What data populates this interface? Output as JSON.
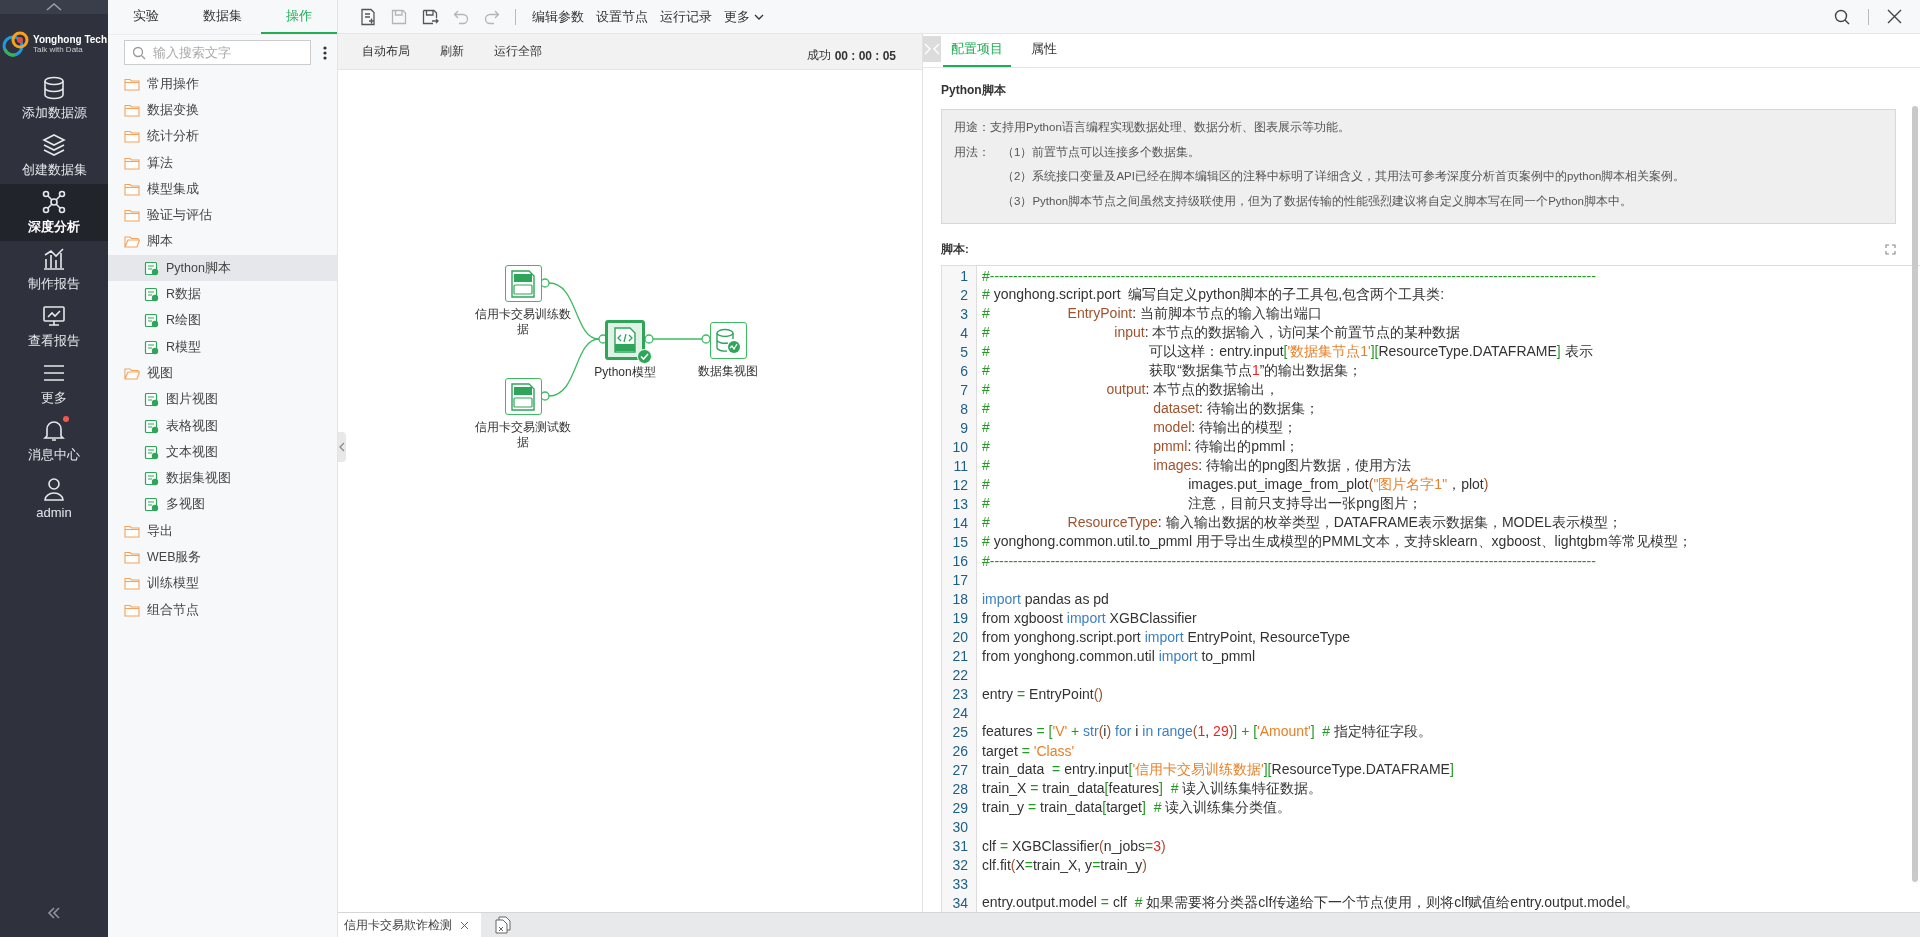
{
  "nav": {
    "logo": {
      "name": "Yonghong Tech",
      "slogan": "Talk with Data"
    },
    "items": [
      {
        "label": "添加数据源",
        "selected": false,
        "unread": false
      },
      {
        "label": "创建数据集",
        "selected": false,
        "unread": false
      },
      {
        "label": "深度分析",
        "selected": true,
        "unread": false
      },
      {
        "label": "制作报告",
        "selected": false,
        "unread": false
      },
      {
        "label": "查看报告",
        "selected": false,
        "unread": false
      },
      {
        "label": "更多",
        "selected": false,
        "unread": false
      },
      {
        "label": "消息中心",
        "selected": false,
        "unread": true
      },
      {
        "label": "admin",
        "selected": false,
        "unread": false
      }
    ]
  },
  "tree_panel": {
    "tabs": [
      {
        "label": "实验",
        "selected": false
      },
      {
        "label": "数据集",
        "selected": false
      },
      {
        "label": "操作",
        "selected": true
      }
    ],
    "search": {
      "placeholder": "输入搜索文字"
    },
    "items": [
      {
        "label": "常用操作",
        "expanded": false,
        "selected": false
      },
      {
        "label": "数据变换",
        "expanded": false,
        "selected": false
      },
      {
        "label": "统计分析",
        "expanded": false,
        "selected": false
      },
      {
        "label": "算法",
        "expanded": false,
        "selected": false
      },
      {
        "label": "模型集成",
        "expanded": false,
        "selected": false
      },
      {
        "label": "验证与评估",
        "expanded": false,
        "selected": false
      },
      {
        "label": "脚本",
        "expanded": true,
        "selected": false,
        "children": [
          {
            "label": "Python脚本",
            "selected": true
          },
          {
            "label": "R数据",
            "selected": false
          },
          {
            "label": "R绘图",
            "selected": false
          },
          {
            "label": "R模型",
            "selected": false
          }
        ]
      },
      {
        "label": "视图",
        "expanded": true,
        "selected": false,
        "children": [
          {
            "label": "图片视图",
            "selected": false
          },
          {
            "label": "表格视图",
            "selected": false
          },
          {
            "label": "文本视图",
            "selected": false
          },
          {
            "label": "数据集视图",
            "selected": false
          },
          {
            "label": "多视图",
            "selected": false
          }
        ]
      },
      {
        "label": "导出",
        "expanded": false,
        "selected": false
      },
      {
        "label": "WEB服务",
        "expanded": false,
        "selected": false
      },
      {
        "label": "训练模型",
        "expanded": false,
        "selected": false
      },
      {
        "label": "组合节点",
        "expanded": false,
        "selected": false
      }
    ]
  },
  "toolbar": {
    "icon_buttons": [
      {
        "disabled": false
      },
      {
        "disabled": true
      },
      {
        "disabled": false
      },
      {
        "disabled": true
      },
      {
        "disabled": true
      }
    ],
    "buttons": [
      "编辑参数",
      "设置节点",
      "运行记录"
    ],
    "more": "更多"
  },
  "canvas_bar": {
    "buttons": [
      "自动布局",
      "刷新",
      "运行全部"
    ],
    "status": "成功",
    "elapsed": "00 : 00 : 05"
  },
  "flow": {
    "nodes": [
      {
        "label": "信用卡交易训练数据",
        "kind": "sql",
        "done": false
      },
      {
        "label": "信用卡交易测试数据",
        "kind": "sql",
        "done": false
      },
      {
        "label": "Python模型",
        "kind": "python",
        "done": true
      },
      {
        "label": "数据集视图",
        "kind": "dataset",
        "done": false
      }
    ]
  },
  "config_panel": {
    "tabs": [
      {
        "label": "配置项目",
        "selected": true
      },
      {
        "label": "属性",
        "selected": false
      }
    ],
    "title": "Python脚本",
    "description": {
      "usage": "用途：支持用Python语言编程实现数据处理、数据分析、图表展示等功能。",
      "method_label": "用法：",
      "method_items": [
        "（1）前置节点可以连接多个数据集。",
        "（2）系统接口变量及API已经在脚本编辑区的注释中标明了详细含义，其用法可参考深度分析首页案例中的python脚本相关案例。",
        "（3）Python脚本节点之间虽然支持级联使用，但为了数据传输的性能强烈建议将自定义脚本写在同一个Python脚本中。"
      ]
    },
    "script_label": "脚本:",
    "code_lines": [
      {
        "no": "1",
        "segs": [
          {
            "text": "#----------------------------------------------------------------------------------------------------------------------------------",
            "kind": "comment"
          }
        ]
      },
      {
        "no": "2",
        "segs": [
          {
            "text": "#",
            "kind": "comment"
          },
          {
            "text": " yonghong.script.port  编写自定义python脚本的子工具包,包含两个工具类:",
            "kind": "plain"
          }
        ]
      },
      {
        "no": "3",
        "segs": [
          {
            "text": "#",
            "kind": "comment"
          },
          {
            "text": "                    EntryPoint",
            "kind": "name"
          },
          {
            "text": ": 当前脚本节点的输入输出端口",
            "kind": "plain"
          }
        ]
      },
      {
        "no": "4",
        "segs": [
          {
            "text": "#",
            "kind": "comment"
          },
          {
            "text": "                                input",
            "kind": "name"
          },
          {
            "text": ": 本节点的数据输入，访问某个前置节点的某种数据",
            "kind": "plain"
          }
        ]
      },
      {
        "no": "5",
        "segs": [
          {
            "text": "#",
            "kind": "comment"
          },
          {
            "text": "                                         可以这样：entry.input",
            "kind": "plain"
          },
          {
            "text": "[",
            "kind": "punct"
          },
          {
            "text": "'数据集节点1'",
            "kind": "string"
          },
          {
            "text": "][",
            "kind": "punct"
          },
          {
            "text": "ResourceType.DATAFRAME",
            "kind": "plain"
          },
          {
            "text": "]",
            "kind": "punct"
          },
          {
            "text": " 表示",
            "kind": "plain"
          }
        ]
      },
      {
        "no": "6",
        "segs": [
          {
            "text": "#",
            "kind": "comment"
          },
          {
            "text": "                                         获取“数据集节点",
            "kind": "plain"
          },
          {
            "text": "1",
            "kind": "number"
          },
          {
            "text": "”的输出数据集；",
            "kind": "plain"
          }
        ]
      },
      {
        "no": "7",
        "segs": [
          {
            "text": "#",
            "kind": "comment"
          },
          {
            "text": "                              output",
            "kind": "name"
          },
          {
            "text": ": 本节点的数据输出，",
            "kind": "plain"
          }
        ]
      },
      {
        "no": "8",
        "segs": [
          {
            "text": "#",
            "kind": "comment"
          },
          {
            "text": "                                          dataset",
            "kind": "name"
          },
          {
            "text": ": 待输出的数据集；",
            "kind": "plain"
          }
        ]
      },
      {
        "no": "9",
        "segs": [
          {
            "text": "#",
            "kind": "comment"
          },
          {
            "text": "                                          model",
            "kind": "name"
          },
          {
            "text": ": 待输出的模型；",
            "kind": "plain"
          }
        ]
      },
      {
        "no": "10",
        "segs": [
          {
            "text": "#",
            "kind": "comment"
          },
          {
            "text": "                                          pmml",
            "kind": "name"
          },
          {
            "text": ": 待输出的pmml；",
            "kind": "plain"
          }
        ]
      },
      {
        "no": "11",
        "segs": [
          {
            "text": "#",
            "kind": "comment"
          },
          {
            "text": "                                          images",
            "kind": "name"
          },
          {
            "text": ": 待输出的png图片数据，使用方法",
            "kind": "plain"
          }
        ]
      },
      {
        "no": "12",
        "segs": [
          {
            "text": "#",
            "kind": "comment"
          },
          {
            "text": "                                                   images.put_image_from_plot",
            "kind": "plain"
          },
          {
            "text": "(",
            "kind": "paren"
          },
          {
            "text": "\"图片名字1\"",
            "kind": "string"
          },
          {
            "text": "，plot",
            "kind": "plain"
          },
          {
            "text": ")",
            "kind": "paren"
          }
        ]
      },
      {
        "no": "13",
        "segs": [
          {
            "text": "#",
            "kind": "comment"
          },
          {
            "text": "                                                   注意，目前只支持导出一张png图片；",
            "kind": "plain"
          }
        ]
      },
      {
        "no": "14",
        "segs": [
          {
            "text": "#",
            "kind": "comment"
          },
          {
            "text": "                    ResourceType",
            "kind": "name"
          },
          {
            "text": ": 输入输出数据的枚举类型，DATAFRAME表示数据集，MODEL表示模型；",
            "kind": "plain"
          }
        ]
      },
      {
        "no": "15",
        "segs": [
          {
            "text": "#",
            "kind": "comment"
          },
          {
            "text": " yonghong.common.util.to_pmml 用于导出生成模型的PMML文本，支持sklearn、xgboost、lightgbm等常见模型；",
            "kind": "plain"
          }
        ]
      },
      {
        "no": "16",
        "segs": [
          {
            "text": "#----------------------------------------------------------------------------------------------------------------------------------",
            "kind": "comment"
          }
        ]
      },
      {
        "no": "17"
      },
      {
        "no": "18",
        "segs": [
          {
            "text": "import",
            "kind": "keyword"
          },
          {
            "text": " pandas as pd",
            "kind": "plain"
          }
        ]
      },
      {
        "no": "19",
        "segs": [
          {
            "text": "from xgboost ",
            "kind": "plain"
          },
          {
            "text": "import",
            "kind": "keyword"
          },
          {
            "text": " XGBClassifier",
            "kind": "plain"
          }
        ]
      },
      {
        "no": "20",
        "segs": [
          {
            "text": "from yonghong.script.port ",
            "kind": "plain"
          },
          {
            "text": "import",
            "kind": "keyword"
          },
          {
            "text": " EntryPoint, ResourceType",
            "kind": "plain"
          }
        ]
      },
      {
        "no": "21",
        "segs": [
          {
            "text": "from yonghong.common.util ",
            "kind": "plain"
          },
          {
            "text": "import",
            "kind": "keyword"
          },
          {
            "text": " to_pmml",
            "kind": "plain"
          }
        ]
      },
      {
        "no": "22"
      },
      {
        "no": "23",
        "segs": [
          {
            "text": "entry ",
            "kind": "plain"
          },
          {
            "text": "=",
            "kind": "punct"
          },
          {
            "text": " EntryPoint",
            "kind": "plain"
          },
          {
            "text": "()",
            "kind": "paren"
          }
        ]
      },
      {
        "no": "24"
      },
      {
        "no": "25",
        "segs": [
          {
            "text": "features ",
            "kind": "plain"
          },
          {
            "text": "= [",
            "kind": "punct"
          },
          {
            "text": "'V'",
            "kind": "string"
          },
          {
            "text": " + ",
            "kind": "punct"
          },
          {
            "text": "str",
            "kind": "keyword"
          },
          {
            "text": "(",
            "kind": "paren"
          },
          {
            "text": "i",
            "kind": "plain"
          },
          {
            "text": ")",
            "kind": "paren"
          },
          {
            "text": " for",
            "kind": "keyword"
          },
          {
            "text": " i ",
            "kind": "plain"
          },
          {
            "text": "in range",
            "kind": "keyword"
          },
          {
            "text": "(",
            "kind": "paren"
          },
          {
            "text": "1",
            "kind": "number"
          },
          {
            "text": ", ",
            "kind": "plain"
          },
          {
            "text": "29",
            "kind": "number"
          },
          {
            "text": ")",
            "kind": "paren"
          },
          {
            "text": "] + [",
            "kind": "punct"
          },
          {
            "text": "'Amount'",
            "kind": "string"
          },
          {
            "text": "]  #",
            "kind": "punct"
          },
          {
            "text": " 指定特征字段。",
            "kind": "plain"
          }
        ]
      },
      {
        "no": "26",
        "segs": [
          {
            "text": "target ",
            "kind": "plain"
          },
          {
            "text": "= ",
            "kind": "punct"
          },
          {
            "text": "'Class'",
            "kind": "string"
          }
        ]
      },
      {
        "no": "27",
        "segs": [
          {
            "text": "train_data  ",
            "kind": "plain"
          },
          {
            "text": "=",
            "kind": "punct"
          },
          {
            "text": " entry.input",
            "kind": "plain"
          },
          {
            "text": "[",
            "kind": "punct"
          },
          {
            "text": "'信用卡交易训练数据'",
            "kind": "string"
          },
          {
            "text": "][",
            "kind": "punct"
          },
          {
            "text": "ResourceType.DATAFRAME",
            "kind": "plain"
          },
          {
            "text": "]",
            "kind": "punct"
          }
        ]
      },
      {
        "no": "28",
        "segs": [
          {
            "text": "train_X ",
            "kind": "plain"
          },
          {
            "text": "=",
            "kind": "punct"
          },
          {
            "text": " train_data",
            "kind": "plain"
          },
          {
            "text": "[",
            "kind": "punct"
          },
          {
            "text": "features",
            "kind": "plain"
          },
          {
            "text": "]  #",
            "kind": "punct"
          },
          {
            "text": " 读入训练集特征数据。",
            "kind": "plain"
          }
        ]
      },
      {
        "no": "29",
        "segs": [
          {
            "text": "train_y ",
            "kind": "plain"
          },
          {
            "text": "=",
            "kind": "punct"
          },
          {
            "text": " train_data",
            "kind": "plain"
          },
          {
            "text": "[",
            "kind": "punct"
          },
          {
            "text": "target",
            "kind": "plain"
          },
          {
            "text": "]  #",
            "kind": "punct"
          },
          {
            "text": " 读入训练集分类值。",
            "kind": "plain"
          }
        ]
      },
      {
        "no": "30"
      },
      {
        "no": "31",
        "segs": [
          {
            "text": "clf ",
            "kind": "plain"
          },
          {
            "text": "=",
            "kind": "punct"
          },
          {
            "text": " XGBClassifier",
            "kind": "plain"
          },
          {
            "text": "(",
            "kind": "paren"
          },
          {
            "text": "n_jobs",
            "kind": "plain"
          },
          {
            "text": "=",
            "kind": "punct"
          },
          {
            "text": "3",
            "kind": "number"
          },
          {
            "text": ")",
            "kind": "paren"
          }
        ]
      },
      {
        "no": "32",
        "segs": [
          {
            "text": "clf.fit",
            "kind": "plain"
          },
          {
            "text": "(",
            "kind": "paren"
          },
          {
            "text": "X",
            "kind": "plain"
          },
          {
            "text": "=",
            "kind": "punct"
          },
          {
            "text": "train_X, y",
            "kind": "plain"
          },
          {
            "text": "=",
            "kind": "punct"
          },
          {
            "text": "train_y",
            "kind": "plain"
          },
          {
            "text": ")",
            "kind": "paren"
          }
        ]
      },
      {
        "no": "33"
      },
      {
        "no": "34",
        "segs": [
          {
            "text": "entry.output.model ",
            "kind": "plain"
          },
          {
            "text": "=",
            "kind": "punct"
          },
          {
            "text": " clf  ",
            "kind": "plain"
          },
          {
            "text": "#",
            "kind": "comment"
          },
          {
            "text": " 如果需要将分类器clf传递给下一个节点使用，则将clf赋值给entry.output.model。",
            "kind": "plain"
          }
        ]
      }
    ]
  },
  "bottom_bar": {
    "tabs": [
      {
        "label": "信用卡交易欺诈检测",
        "selected": true
      }
    ]
  }
}
